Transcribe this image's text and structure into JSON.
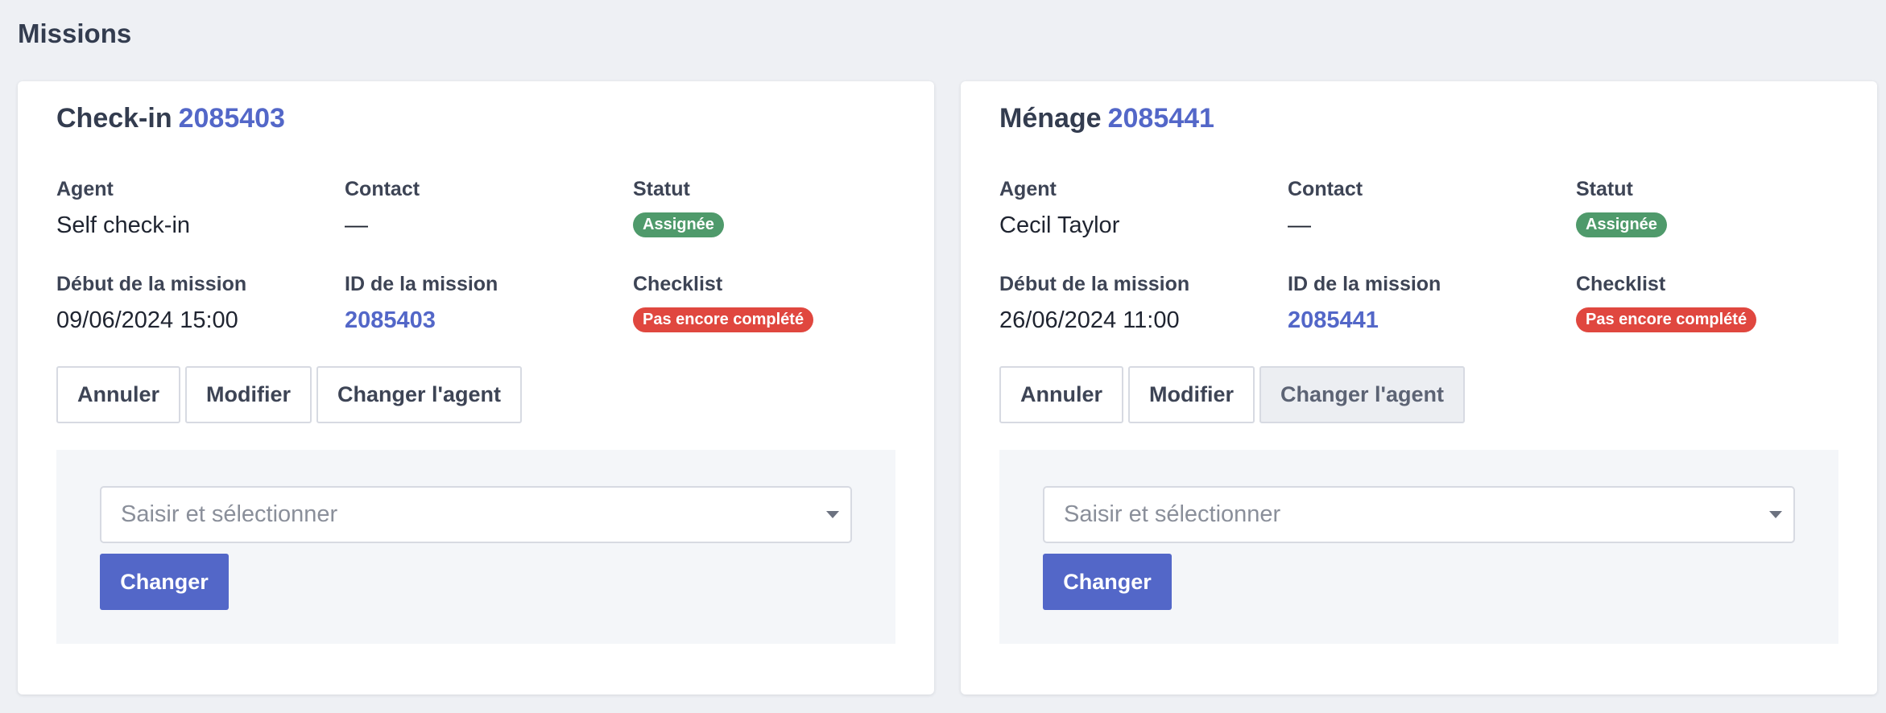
{
  "page": {
    "title": "Missions"
  },
  "colors": {
    "accent": "#5367c8",
    "status_assigned": "#4f9a6b",
    "checklist_incomplete": "#e0473f"
  },
  "missions": [
    {
      "type": "Check-in",
      "id": "2085403",
      "agent_label": "Agent",
      "agent_value": "Self check-in",
      "contact_label": "Contact",
      "contact_value": "—",
      "status_label": "Statut",
      "status_badge": "Assignée",
      "start_label": "Début de la mission",
      "start_value": "09/06/2024 15:00",
      "mission_id_label": "ID de la mission",
      "mission_id_value": "2085403",
      "checklist_label": "Checklist",
      "checklist_badge": "Pas encore complété",
      "buttons": {
        "cancel": "Annuler",
        "edit": "Modifier",
        "change_agent": "Changer l'agent"
      },
      "agent_select": {
        "placeholder": "Saisir et sélectionner",
        "submit": "Changer"
      }
    },
    {
      "type": "Ménage",
      "id": "2085441",
      "agent_label": "Agent",
      "agent_value": "Cecil Taylor",
      "contact_label": "Contact",
      "contact_value": "—",
      "status_label": "Statut",
      "status_badge": "Assignée",
      "start_label": "Début de la mission",
      "start_value": "26/06/2024 11:00",
      "mission_id_label": "ID de la mission",
      "mission_id_value": "2085441",
      "checklist_label": "Checklist",
      "checklist_badge": "Pas encore complété",
      "buttons": {
        "cancel": "Annuler",
        "edit": "Modifier",
        "change_agent": "Changer l'agent"
      },
      "agent_select": {
        "placeholder": "Saisir et sélectionner",
        "submit": "Changer"
      }
    }
  ]
}
